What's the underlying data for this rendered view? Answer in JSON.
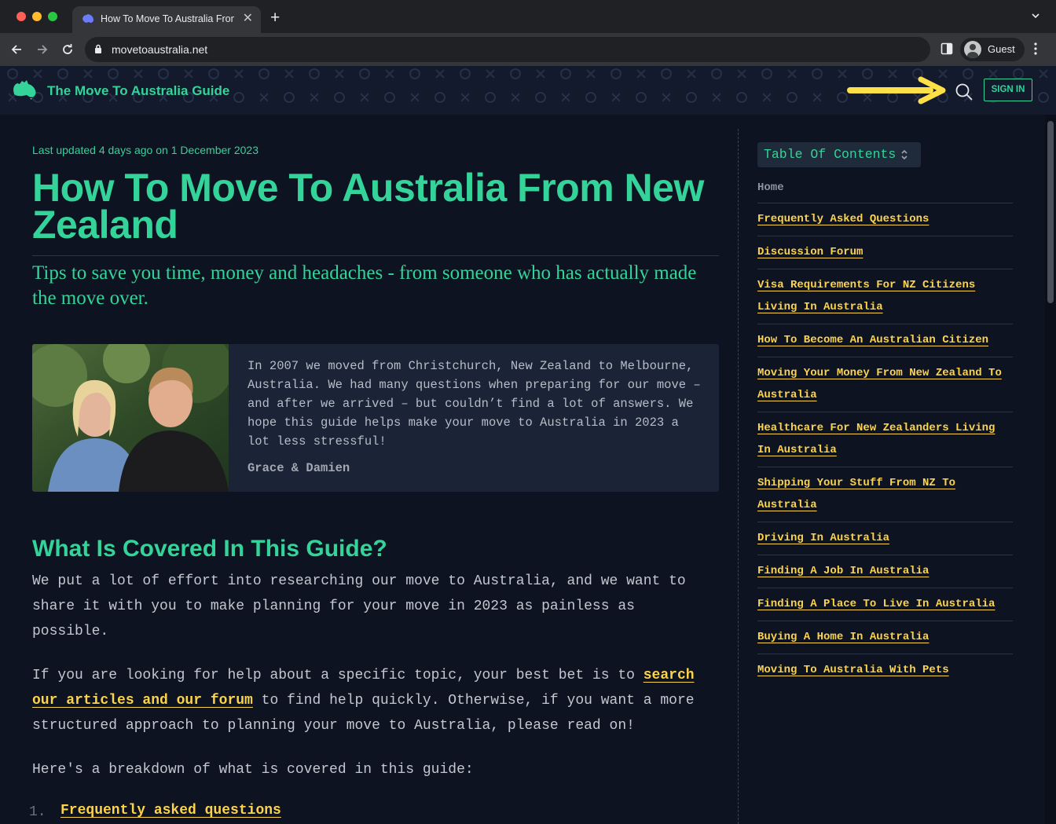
{
  "browser": {
    "tab_title": "How To Move To Australia From New Zealand",
    "tab_close": "✕",
    "new_tab": "+",
    "url": "movetoaustralia.net",
    "profile_label": "Guest"
  },
  "header": {
    "site_title": "The Move To Australia Guide",
    "signin_label": "SIGN IN",
    "accent_color": "#34d399",
    "arrow_color": "#fde047"
  },
  "article": {
    "updated": "Last updated 4 days ago on 1 December 2023",
    "title": "How To Move To Australia From New Zealand",
    "subtitle": "Tips to save you time, money and headaches - from someone who has actually made the move over.",
    "intro_text": "In 2007 we moved from Christchurch, New Zealand to Melbourne, Australia. We had many questions when preparing for our move – and after we arrived – but couldn’t find a lot of answers. We hope this guide helps make your move to Australia in 2023 a lot less stressful!",
    "intro_signature": "Grace & Damien",
    "section_heading": "What Is Covered In This Guide?",
    "para1": "We put a lot of effort into researching our move to Australia, and we want to share it with you to make planning for your move in 2023 as painless as possible.",
    "para2_before": "If you are looking for help about a specific topic, your best bet is to ",
    "para2_link": "search our articles and our forum",
    "para2_after": " to find help quickly. Otherwise, if you want a more structured approach to planning your move to Australia, please read on!",
    "para3": "Here's a breakdown of what is covered in this guide:",
    "list": [
      {
        "num": "1.",
        "label": "Frequently asked questions"
      }
    ]
  },
  "toc": {
    "button_label": "Table Of Contents",
    "home": "Home",
    "items": [
      "Frequently Asked Questions",
      "Discussion Forum",
      "Visa Requirements For NZ Citizens Living In Australia",
      "How To Become An Australian Citizen",
      "Moving Your Money From New Zealand To Australia",
      "Healthcare For New Zealanders Living In Australia",
      "Shipping Your Stuff From NZ To Australia",
      "Driving In Australia",
      "Finding A Job In Australia",
      "Finding A Place To Live In Australia",
      "Buying A Home In Australia",
      "Moving To Australia With Pets"
    ]
  }
}
